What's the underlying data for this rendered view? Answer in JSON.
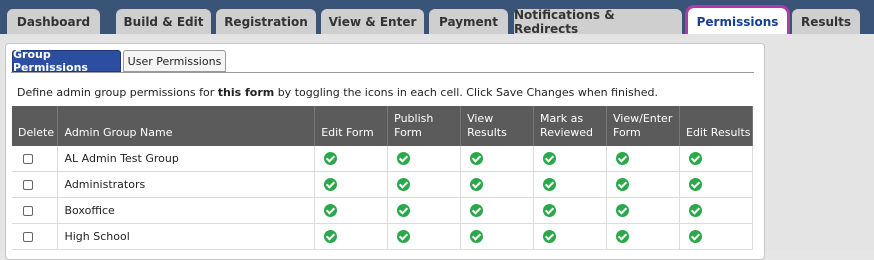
{
  "top_tabs": [
    {
      "label": "Dashboard"
    },
    {
      "label": "Build & Edit"
    },
    {
      "label": "Registration"
    },
    {
      "label": "View & Enter"
    },
    {
      "label": "Payment"
    },
    {
      "label": "Notifications & Redirects"
    },
    {
      "label": "Permissions",
      "active": true
    },
    {
      "label": "Results"
    }
  ],
  "sub_tabs": [
    {
      "label": "Group Permissions",
      "active": true
    },
    {
      "label": "User Permissions"
    }
  ],
  "instructions": {
    "before": "Define admin group permissions for ",
    "bold": "this form",
    "after": " by toggling the icons in each cell. Click Save Changes when finished."
  },
  "table": {
    "headers": [
      "Delete",
      "Admin Group Name",
      "Edit Form",
      "Publish Form",
      "View Results",
      "Mark as Reviewed",
      "View/Enter Form",
      "Edit Results"
    ],
    "rows": [
      {
        "name": "AL Admin Test Group",
        "permissions": [
          true,
          true,
          true,
          true,
          true,
          true
        ]
      },
      {
        "name": "Administrators",
        "permissions": [
          true,
          true,
          true,
          true,
          true,
          true
        ]
      },
      {
        "name": "Boxoffice",
        "permissions": [
          true,
          true,
          true,
          true,
          true,
          true
        ]
      },
      {
        "name": "High School",
        "permissions": [
          true,
          true,
          true,
          true,
          true,
          true
        ]
      }
    ]
  },
  "colors": {
    "topbar": "#3a5478",
    "active_highlight": "#b03aa8",
    "active_subtab": "#2b4ea0",
    "granted_icon": "#2aa84a",
    "header_bg": "#5b5b5b"
  },
  "icons": {
    "granted": "check-circle-icon"
  }
}
